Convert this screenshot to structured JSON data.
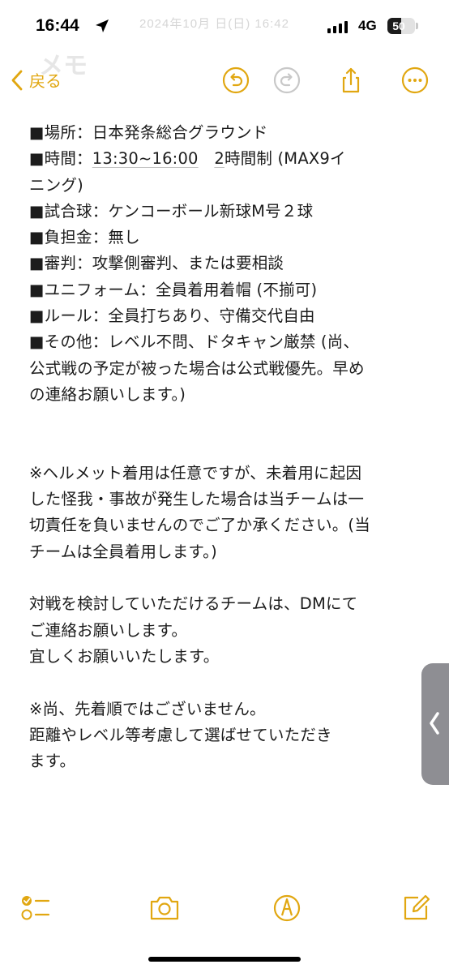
{
  "status_bar": {
    "time": "16:44",
    "network": "4G",
    "battery": "50",
    "battery_level": 0.5,
    "ghost_timestamp": "2024年10月 日(日) 16:42"
  },
  "ghost_title": "メモ",
  "nav": {
    "back_label": "戻る",
    "accent_color": "#E1A711",
    "icons": [
      "undo-icon",
      "redo-icon",
      "share-icon",
      "more-icon"
    ]
  },
  "note": {
    "lines": [
      "■場所：日本発条総合グラウンド",
      "■時間：13:30~16:00　2時間制 (MAX9イ",
      "ニング)",
      "■試合球：ケンコーボール新球M号２球",
      "■負担金：無し",
      "■審判：攻撃側審判、または要相談",
      "■ユニフォーム：全員着用着帽 (不揃可)",
      "■ルール：全員打ちあり、守備交代自由",
      "■その他：レベル不問、ドタキャン厳禁 (尚、",
      "公式戦の予定が被った場合は公式戦優先。早め",
      "の連絡お願いします。)",
      "",
      "",
      "※ヘルメット着用は任意ですが、未着用に起因",
      "した怪我・事故が発生した場合は当チームは一",
      "切責任を負いませんのでご了か承ください。(当",
      "チームは全員着用します。)",
      "",
      "対戦を検討していただけるチームは、DMにて",
      "ご連絡お願いします。",
      "宜しくお願いいたします。",
      "",
      "※尚、先着順ではございません。",
      "距離やレベル等考慮して選ばせていただき",
      "ます。"
    ],
    "time_prefix": "■時間：",
    "time_range": "13:30~16:00",
    "time_sep": "　",
    "time_duration": "2",
    "time_suffix": "時間制 (MAX9イ"
  },
  "toolbar": {
    "icons": [
      "checklist-icon",
      "camera-icon",
      "markup-pen-icon",
      "compose-icon"
    ]
  }
}
